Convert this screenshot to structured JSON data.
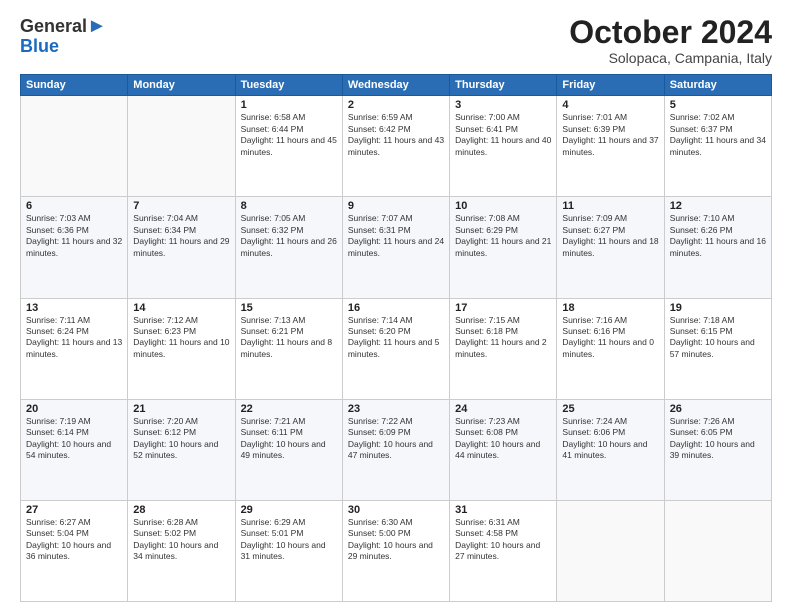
{
  "header": {
    "logo_line1": "General",
    "logo_line2": "Blue",
    "month_title": "October 2024",
    "location": "Solopaca, Campania, Italy"
  },
  "weekdays": [
    "Sunday",
    "Monday",
    "Tuesday",
    "Wednesday",
    "Thursday",
    "Friday",
    "Saturday"
  ],
  "weeks": [
    [
      {
        "day": "",
        "info": ""
      },
      {
        "day": "",
        "info": ""
      },
      {
        "day": "1",
        "info": "Sunrise: 6:58 AM\nSunset: 6:44 PM\nDaylight: 11 hours and 45 minutes."
      },
      {
        "day": "2",
        "info": "Sunrise: 6:59 AM\nSunset: 6:42 PM\nDaylight: 11 hours and 43 minutes."
      },
      {
        "day": "3",
        "info": "Sunrise: 7:00 AM\nSunset: 6:41 PM\nDaylight: 11 hours and 40 minutes."
      },
      {
        "day": "4",
        "info": "Sunrise: 7:01 AM\nSunset: 6:39 PM\nDaylight: 11 hours and 37 minutes."
      },
      {
        "day": "5",
        "info": "Sunrise: 7:02 AM\nSunset: 6:37 PM\nDaylight: 11 hours and 34 minutes."
      }
    ],
    [
      {
        "day": "6",
        "info": "Sunrise: 7:03 AM\nSunset: 6:36 PM\nDaylight: 11 hours and 32 minutes."
      },
      {
        "day": "7",
        "info": "Sunrise: 7:04 AM\nSunset: 6:34 PM\nDaylight: 11 hours and 29 minutes."
      },
      {
        "day": "8",
        "info": "Sunrise: 7:05 AM\nSunset: 6:32 PM\nDaylight: 11 hours and 26 minutes."
      },
      {
        "day": "9",
        "info": "Sunrise: 7:07 AM\nSunset: 6:31 PM\nDaylight: 11 hours and 24 minutes."
      },
      {
        "day": "10",
        "info": "Sunrise: 7:08 AM\nSunset: 6:29 PM\nDaylight: 11 hours and 21 minutes."
      },
      {
        "day": "11",
        "info": "Sunrise: 7:09 AM\nSunset: 6:27 PM\nDaylight: 11 hours and 18 minutes."
      },
      {
        "day": "12",
        "info": "Sunrise: 7:10 AM\nSunset: 6:26 PM\nDaylight: 11 hours and 16 minutes."
      }
    ],
    [
      {
        "day": "13",
        "info": "Sunrise: 7:11 AM\nSunset: 6:24 PM\nDaylight: 11 hours and 13 minutes."
      },
      {
        "day": "14",
        "info": "Sunrise: 7:12 AM\nSunset: 6:23 PM\nDaylight: 11 hours and 10 minutes."
      },
      {
        "day": "15",
        "info": "Sunrise: 7:13 AM\nSunset: 6:21 PM\nDaylight: 11 hours and 8 minutes."
      },
      {
        "day": "16",
        "info": "Sunrise: 7:14 AM\nSunset: 6:20 PM\nDaylight: 11 hours and 5 minutes."
      },
      {
        "day": "17",
        "info": "Sunrise: 7:15 AM\nSunset: 6:18 PM\nDaylight: 11 hours and 2 minutes."
      },
      {
        "day": "18",
        "info": "Sunrise: 7:16 AM\nSunset: 6:16 PM\nDaylight: 11 hours and 0 minutes."
      },
      {
        "day": "19",
        "info": "Sunrise: 7:18 AM\nSunset: 6:15 PM\nDaylight: 10 hours and 57 minutes."
      }
    ],
    [
      {
        "day": "20",
        "info": "Sunrise: 7:19 AM\nSunset: 6:14 PM\nDaylight: 10 hours and 54 minutes."
      },
      {
        "day": "21",
        "info": "Sunrise: 7:20 AM\nSunset: 6:12 PM\nDaylight: 10 hours and 52 minutes."
      },
      {
        "day": "22",
        "info": "Sunrise: 7:21 AM\nSunset: 6:11 PM\nDaylight: 10 hours and 49 minutes."
      },
      {
        "day": "23",
        "info": "Sunrise: 7:22 AM\nSunset: 6:09 PM\nDaylight: 10 hours and 47 minutes."
      },
      {
        "day": "24",
        "info": "Sunrise: 7:23 AM\nSunset: 6:08 PM\nDaylight: 10 hours and 44 minutes."
      },
      {
        "day": "25",
        "info": "Sunrise: 7:24 AM\nSunset: 6:06 PM\nDaylight: 10 hours and 41 minutes."
      },
      {
        "day": "26",
        "info": "Sunrise: 7:26 AM\nSunset: 6:05 PM\nDaylight: 10 hours and 39 minutes."
      }
    ],
    [
      {
        "day": "27",
        "info": "Sunrise: 6:27 AM\nSunset: 5:04 PM\nDaylight: 10 hours and 36 minutes."
      },
      {
        "day": "28",
        "info": "Sunrise: 6:28 AM\nSunset: 5:02 PM\nDaylight: 10 hours and 34 minutes."
      },
      {
        "day": "29",
        "info": "Sunrise: 6:29 AM\nSunset: 5:01 PM\nDaylight: 10 hours and 31 minutes."
      },
      {
        "day": "30",
        "info": "Sunrise: 6:30 AM\nSunset: 5:00 PM\nDaylight: 10 hours and 29 minutes."
      },
      {
        "day": "31",
        "info": "Sunrise: 6:31 AM\nSunset: 4:58 PM\nDaylight: 10 hours and 27 minutes."
      },
      {
        "day": "",
        "info": ""
      },
      {
        "day": "",
        "info": ""
      }
    ]
  ]
}
